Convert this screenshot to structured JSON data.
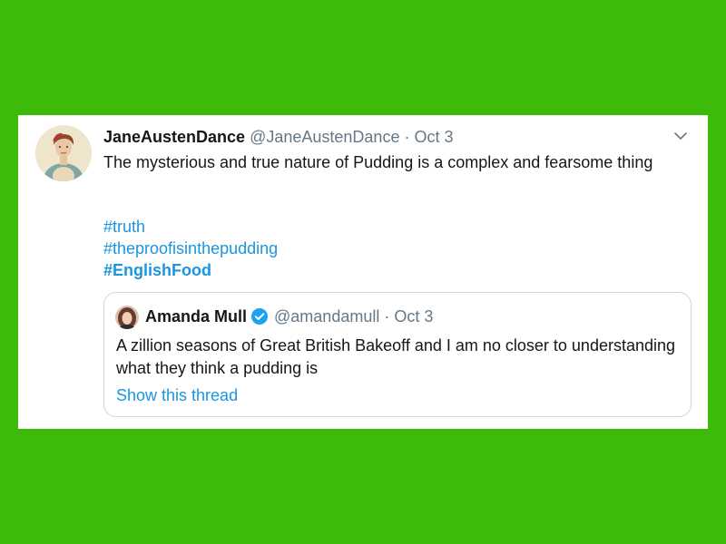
{
  "tweet": {
    "display_name": "JaneAustenDance",
    "handle": "@JaneAustenDance",
    "separator": "·",
    "date": "Oct 3",
    "text": "The mysterious and true nature of Pudding is a complex and fearsome thing",
    "hashtags": [
      "#truth",
      "#theproofisinthepudding",
      "#EnglishFood"
    ],
    "menu_icon": "chevron-down-icon"
  },
  "quoted_tweet": {
    "display_name": "Amanda Mull",
    "verified": true,
    "handle": "@amandamull",
    "separator": "·",
    "date": "Oct 3",
    "text": "A zillion seasons of Great British Bakeoff and I am no closer to understanding what they think a pudding is",
    "show_thread_label": "Show this thread"
  },
  "colors": {
    "background": "#3dba0a",
    "card": "#ffffff",
    "link": "#1b95e0",
    "secondary_text": "#657786",
    "primary_text": "#14171a",
    "border": "#ccd6dd"
  }
}
